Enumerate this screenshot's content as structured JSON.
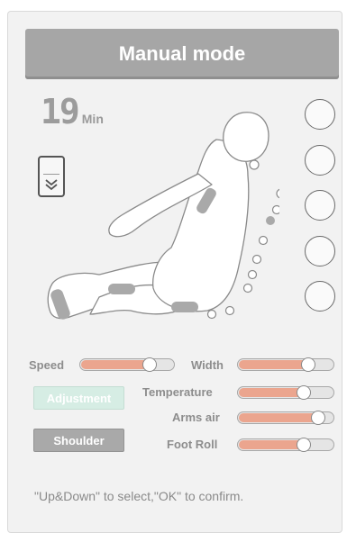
{
  "header": {
    "title": "Manual mode"
  },
  "timer": {
    "value": "19",
    "unit": "Min"
  },
  "massage_points": [
    {
      "id": "neck"
    },
    {
      "id": "upper-back"
    },
    {
      "id": "waist"
    },
    {
      "id": "hips"
    },
    {
      "id": "legs"
    }
  ],
  "settings": {
    "speed": {
      "label": "Speed",
      "level": 0.78
    },
    "width": {
      "label": "Width",
      "level": 0.78
    },
    "temperature": {
      "label": "Temperature",
      "level": 0.72
    },
    "arms_air": {
      "label": "Arms air",
      "level": 0.9
    },
    "foot_roll": {
      "label": "Foot Roll",
      "level": 0.72
    }
  },
  "buttons": {
    "adjustment": "Adjustment",
    "shoulder": "Shoulder"
  },
  "hint": "\"Up&Down\" to select,\"OK\" to confirm.",
  "colors": {
    "slider_fill": "#eba58e",
    "title_bg": "#a6a6a6",
    "adjustment_bg": "#d6ede4",
    "shoulder_bg": "#a9a9a9"
  }
}
